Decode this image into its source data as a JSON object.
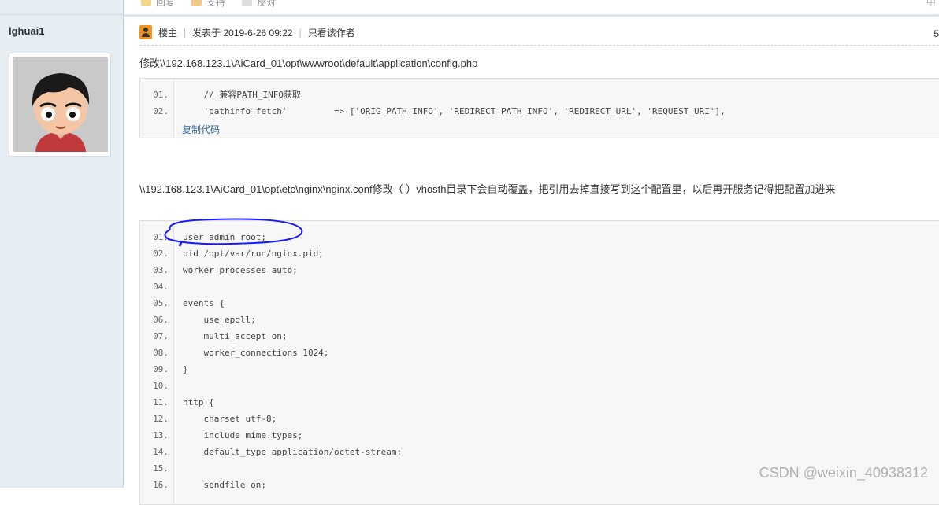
{
  "user": {
    "name": "lghuai1"
  },
  "toolbar": {
    "items": [
      "回复",
      "支持",
      "反对"
    ],
    "right": "中"
  },
  "post": {
    "owner_label": "楼主",
    "posted_at": "发表于 2019-6-26 09:22",
    "author_only": "只看该作者",
    "floor": "5"
  },
  "text1": "修改\\\\192.168.123.1\\AiCard_01\\opt\\wwwroot\\default\\application\\config.php",
  "code1": {
    "lines": [
      {
        "n": "01.",
        "t": "    // 兼容PATH_INFO获取"
      },
      {
        "n": "02.",
        "t": "    'pathinfo_fetch'         => ['ORIG_PATH_INFO', 'REDIRECT_PATH_INFO', 'REDIRECT_URL', 'REQUEST_URI'],"
      }
    ],
    "copy_label": "复制代码"
  },
  "text2": "\\\\192.168.123.1\\AiCard_01\\opt\\etc\\nginx\\nginx.conf修改（  ）vhosth目录下会自动覆盖，把引用去掉直接写到这个配置里，以后再开服务记得把配置加进来",
  "code2": {
    "lines": [
      {
        "n": "01.",
        "t": "user admin root;"
      },
      {
        "n": "02.",
        "t": "pid /opt/var/run/nginx.pid;"
      },
      {
        "n": "03.",
        "t": "worker_processes auto;"
      },
      {
        "n": "04.",
        "t": ""
      },
      {
        "n": "05.",
        "t": "events {"
      },
      {
        "n": "06.",
        "t": "    use epoll;"
      },
      {
        "n": "07.",
        "t": "    multi_accept on;"
      },
      {
        "n": "08.",
        "t": "    worker_connections 1024;"
      },
      {
        "n": "09.",
        "t": "}"
      },
      {
        "n": "10.",
        "t": ""
      },
      {
        "n": "11.",
        "t": "http {"
      },
      {
        "n": "12.",
        "t": "    charset utf-8;"
      },
      {
        "n": "13.",
        "t": "    include mime.types;"
      },
      {
        "n": "14.",
        "t": "    default_type application/octet-stream;"
      },
      {
        "n": "15.",
        "t": ""
      },
      {
        "n": "16.",
        "t": "    sendfile on;"
      }
    ]
  },
  "watermark": "CSDN @weixin_40938312",
  "colors": {
    "sidebar": "#e5edf2",
    "link": "#336699",
    "annotation": "#1a1aff"
  }
}
